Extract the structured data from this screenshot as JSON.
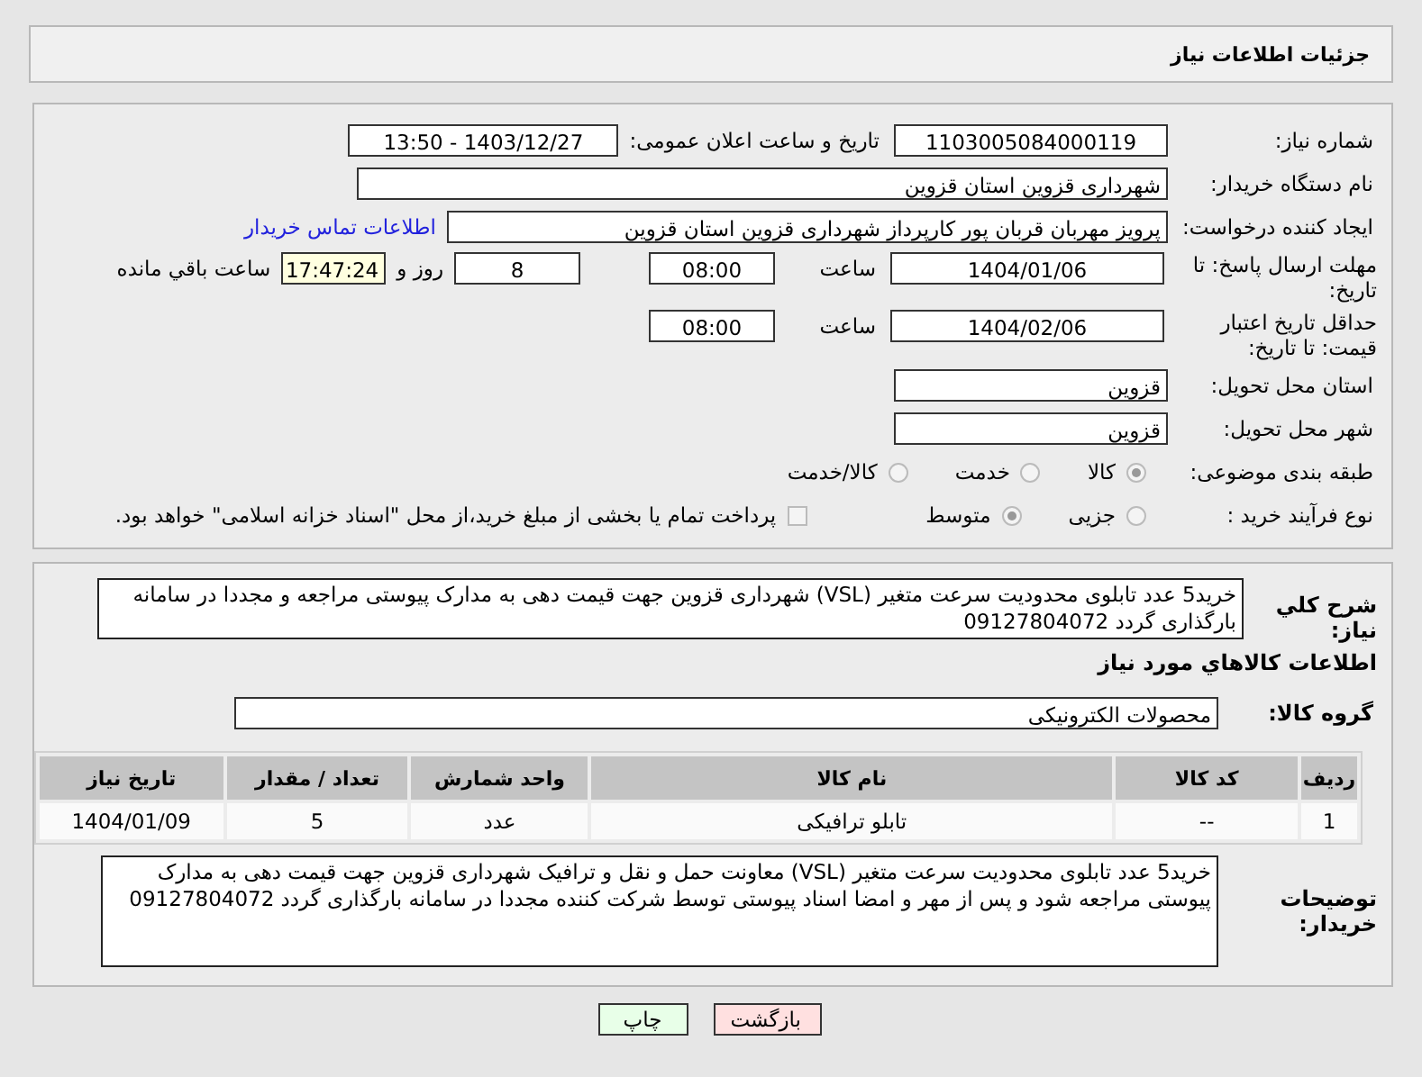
{
  "header": {
    "title": "جزئیات اطلاعات نیاز"
  },
  "need_number": {
    "label": "شماره نیاز:",
    "value": "1103005084000119"
  },
  "announce": {
    "label": "تاریخ و ساعت اعلان عمومی:",
    "value": "1403/12/27 - 13:50"
  },
  "buyer_org": {
    "label": "نام دستگاه خریدار:",
    "value": "شهرداری قزوین استان قزوین"
  },
  "requester": {
    "label": "ایجاد کننده درخواست:",
    "value": "پرویز مهربان قربان پور کارپرداز شهرداری قزوین استان قزوین",
    "link": "اطلاعات تماس خریدار"
  },
  "deadline": {
    "label": "مهلت ارسال پاسخ: تا تاریخ:",
    "date": "1404/01/06",
    "time_label": "ساعت",
    "time": "08:00",
    "days": "8",
    "days_label": "روز و",
    "remaining": "17:47:24",
    "remaining_label": "ساعت باقي مانده"
  },
  "price_validity": {
    "label": "حداقل تاریخ اعتبار قیمت: تا تاریخ:",
    "date": "1404/02/06",
    "time_label": "ساعت",
    "time": "08:00"
  },
  "province": {
    "label": "استان محل تحویل:",
    "value": "قزوین"
  },
  "city": {
    "label": "شهر محل تحویل:",
    "value": "قزوین"
  },
  "category": {
    "label": "طبقه بندی موضوعی:",
    "options": [
      {
        "label": "کالا",
        "selected": true
      },
      {
        "label": "خدمت",
        "selected": false
      },
      {
        "label": "کالا/خدمت",
        "selected": false
      }
    ]
  },
  "purchase_process": {
    "label": "نوع فرآیند خرید :",
    "options": [
      {
        "label": "جزیی",
        "selected": false
      },
      {
        "label": "متوسط",
        "selected": true
      }
    ],
    "treasury": {
      "label": "پرداخت تمام یا بخشی از مبلغ خرید،از محل \"اسناد خزانه اسلامی\" خواهد بود.",
      "checked": false
    }
  },
  "description": {
    "label": "شرح کلي نياز:",
    "value": "خرید5 عدد تابلوی محدودیت سرعت متغیر (VSL) شهرداری قزوین جهت قیمت دهی به مدارک پیوستی مراجعه و مجددا در سامانه بارگذاری گردد 09127804072"
  },
  "goods_title": "اطلاعات کالاهاي مورد نياز",
  "goods_group": {
    "label": "گروه کالا:",
    "value": "محصولات الکترونیکی"
  },
  "table": {
    "columns": [
      "ردیف",
      "کد کالا",
      "نام کالا",
      "واحد شمارش",
      "تعداد / مقدار",
      "تاریخ نیاز"
    ],
    "rows": [
      [
        "1",
        "--",
        "تابلو ترافیکی",
        "عدد",
        "5",
        "1404/01/09"
      ]
    ]
  },
  "buyer_notes": {
    "label": "توضیحات خریدار:",
    "value": "خرید5 عدد تابلوی محدودیت سرعت متغیر (VSL) معاونت حمل و نقل و ترافیک شهرداری قزوین جهت قیمت دهی به مدارک پیوستی مراجعه شود و پس از مهر و امضا اسناد پیوستی توسط شرکت کننده مجددا در سامانه بارگذاری گردد 09127804072"
  },
  "buttons": [
    {
      "kind": "back",
      "label": "بازگشت"
    },
    {
      "kind": "print",
      "label": "چاپ"
    }
  ]
}
